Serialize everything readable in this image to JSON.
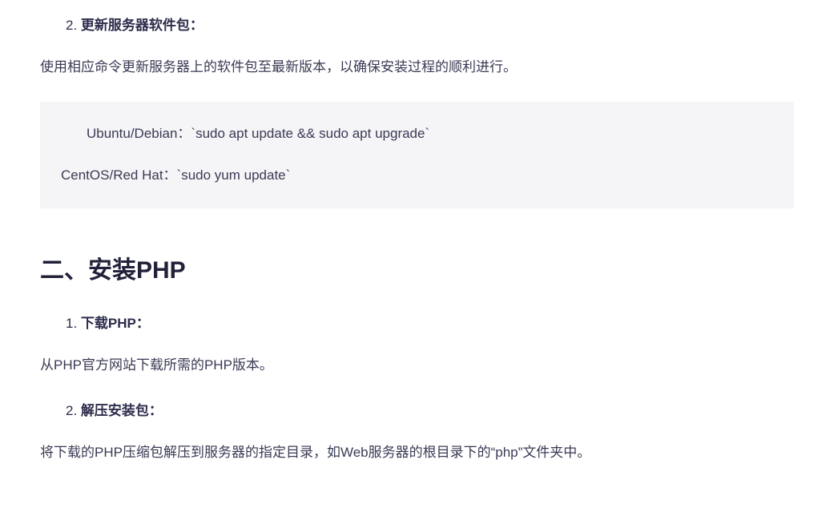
{
  "section1": {
    "item2": {
      "num": "2. ",
      "title": "更新服务器软件包：",
      "desc": "使用相应命令更新服务器上的软件包至最新版本，以确保安装过程的顺利进行。"
    },
    "code": {
      "line1": "Ubuntu/Debian：`sudo apt update && sudo apt upgrade`",
      "line2": "CentOS/Red Hat：`sudo yum update`"
    }
  },
  "section2": {
    "heading": "二、安装PHP",
    "item1": {
      "num": "1. ",
      "title": "下载PHP：",
      "desc": "从PHP官方网站下载所需的PHP版本。"
    },
    "item2": {
      "num": "2. ",
      "title": "解压安装包：",
      "desc": "将下载的PHP压缩包解压到服务器的指定目录，如Web服务器的根目录下的“php”文件夹中。"
    }
  }
}
